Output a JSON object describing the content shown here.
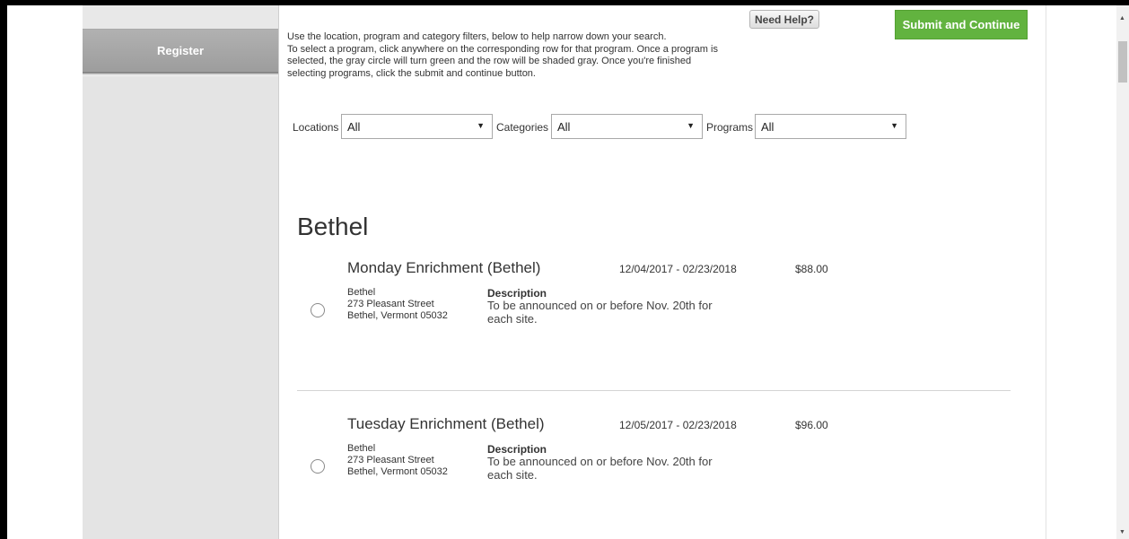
{
  "sidebar": {
    "register_label": "Register"
  },
  "header": {
    "help_label": "Need Help?",
    "submit_label": "Submit and Continue",
    "instructions_line1": "Use the location, program and category filters, below to help narrow down your search.",
    "instructions_line2": "To select a program, click anywhere on the corresponding row for that program. Once a program is selected, the gray circle will turn green and the row will be shaded gray. Once you're finished selecting programs, click the submit and continue button."
  },
  "filters": {
    "locations_label": "Locations",
    "locations_value": "All",
    "categories_label": "Categories",
    "categories_value": "All",
    "programs_label": "Programs",
    "programs_value": "All"
  },
  "section": {
    "title": "Bethel"
  },
  "programs": [
    {
      "name": "Monday Enrichment   (Bethel)",
      "dates": "12/04/2017 - 02/23/2018",
      "price": "$88.00",
      "address_line1": "Bethel",
      "address_line2": "273 Pleasant Street",
      "address_line3": "Bethel, Vermont 05032",
      "description_label": "Description",
      "description": "To be announced on or before Nov. 20th for each site."
    },
    {
      "name": "Tuesday Enrichment   (Bethel)",
      "dates": "12/05/2017 - 02/23/2018",
      "price": "$96.00",
      "address_line1": "Bethel",
      "address_line2": "273 Pleasant Street",
      "address_line3": "Bethel, Vermont 05032",
      "description_label": "Description",
      "description": "To be announced on or before Nov. 20th for each site."
    }
  ],
  "icons": {
    "dropdown": "caret-down-icon",
    "scroll_up": "scroll-up-arrow-icon",
    "scroll_down": "scroll-down-arrow-icon"
  },
  "colors": {
    "submit_green": "#62b33f",
    "sidebar_gray": "#e4e4e4",
    "register_gray": "#a5a5a5"
  }
}
